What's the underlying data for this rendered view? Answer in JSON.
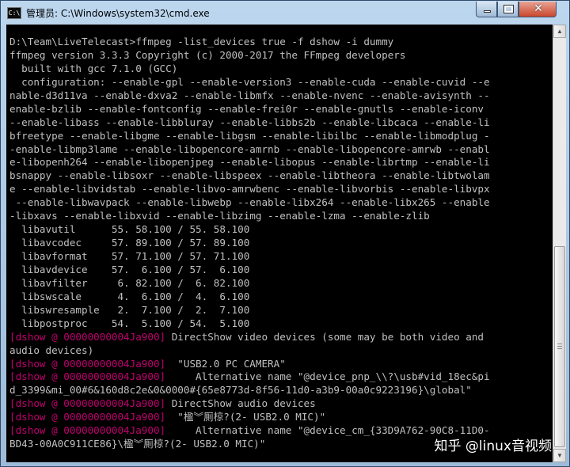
{
  "window": {
    "title": "管理员: C:\\Windows\\system32\\cmd.exe",
    "icon": "cmd-icon",
    "controls": {
      "minimize": "minimize-icon",
      "maximize": "maximize-icon",
      "close": "close-icon",
      "close_glyph": "✕"
    }
  },
  "scrollbar": {
    "up_glyph": "▲",
    "down_glyph": "▼"
  },
  "console": {
    "lines": [
      {
        "text": "D:\\Team\\LiveTelecast>ffmpeg -list_devices true -f dshow -i dummy"
      },
      {
        "text": "ffmpeg version 3.3.3 Copyright (c) 2000-2017 the FFmpeg developers"
      },
      {
        "text": "  built with gcc 7.1.0 (GCC)"
      },
      {
        "text": "  configuration: --enable-gpl --enable-version3 --enable-cuda --enable-cuvid --e"
      },
      {
        "text": "nable-d3d11va --enable-dxva2 --enable-libmfx --enable-nvenc --enable-avisynth --"
      },
      {
        "text": "enable-bzlib --enable-fontconfig --enable-frei0r --enable-gnutls --enable-iconv "
      },
      {
        "text": "--enable-libass --enable-libbluray --enable-libbs2b --enable-libcaca --enable-li"
      },
      {
        "text": "bfreetype --enable-libgme --enable-libgsm --enable-libilbc --enable-libmodplug -"
      },
      {
        "text": "-enable-libmp3lame --enable-libopencore-amrnb --enable-libopencore-amrwb --enabl"
      },
      {
        "text": "e-libopenh264 --enable-libopenjpeg --enable-libopus --enable-librtmp --enable-li"
      },
      {
        "text": "bsnappy --enable-libsoxr --enable-libspeex --enable-libtheora --enable-libtwolam"
      },
      {
        "text": "e --enable-libvidstab --enable-libvo-amrwbenc --enable-libvorbis --enable-libvpx"
      },
      {
        "text": " --enable-libwavpack --enable-libwebp --enable-libx264 --enable-libx265 --enable"
      },
      {
        "text": "-libxavs --enable-libxvid --enable-libzimg --enable-lzma --enable-zlib"
      },
      {
        "text": "  libavutil      55. 58.100 / 55. 58.100"
      },
      {
        "text": "  libavcodec     57. 89.100 / 57. 89.100"
      },
      {
        "text": "  libavformat    57. 71.100 / 57. 71.100"
      },
      {
        "text": "  libavdevice    57.  6.100 / 57.  6.100"
      },
      {
        "text": "  libavfilter     6. 82.100 /  6. 82.100"
      },
      {
        "text": "  libswscale      4.  6.100 /  4.  6.100"
      },
      {
        "text": "  libswresample   2.  7.100 /  2.  7.100"
      },
      {
        "text": "  libpostproc    54.  5.100 / 54.  5.100"
      },
      {
        "tag": "[dshow @ 00000000004Ja900]",
        "text": " DirectShow video devices (some may be both video and"
      },
      {
        "text": "audio devices)"
      },
      {
        "tag": "[dshow @ 00000000004Ja900]",
        "text": "  \"USB2.0 PC CAMERA\""
      },
      {
        "tag": "[dshow @ 00000000004Ja900]",
        "text": "     Alternative name \"@device_pnp_\\\\?\\usb#vid_18ec&pi"
      },
      {
        "text": "d_3399&mi_00#6&160d8c2e&0&0000#{65e8773d-8f56-11d0-a3b9-00a0c9223196}\\global\""
      },
      {
        "tag": "[dshow @ 00000000004Ja900]",
        "text": " DirectShow audio devices"
      },
      {
        "tag": "[dshow @ 00000000004Ja900]",
        "text": "  \"楹︾厠椋?(2- USB2.0 MIC)\""
      },
      {
        "tag": "[dshow @ 00000000004Ja900]",
        "text": "     Alternative name \"@device_cm_{33D9A762-90C8-11D0-"
      },
      {
        "text": "BD43-00A0C911CE86}\\楹︾厠椋?(2- USB2.0 MIC)\""
      }
    ]
  },
  "watermark": {
    "text": "知乎 @linux音视频"
  }
}
